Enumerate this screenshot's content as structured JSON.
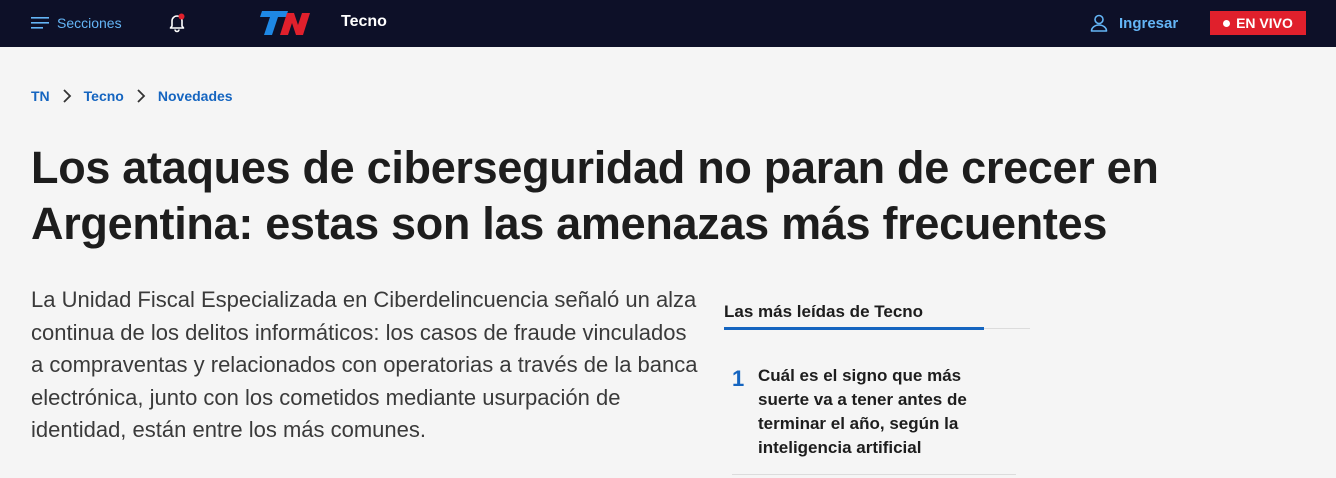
{
  "header": {
    "menu_label": "Secciones",
    "section": "Tecno",
    "login_label": "Ingresar",
    "live_label": "EN VIVO",
    "logo_alt": "TN",
    "icons": {
      "menu": "hamburger-icon",
      "notifications": "bell-icon",
      "login": "user-icon"
    },
    "colors": {
      "bar": "#0d1028",
      "accent": "#64b5f6",
      "live": "#e0202c"
    }
  },
  "breadcrumb": {
    "items": [
      "TN",
      "Tecno",
      "Novedades"
    ]
  },
  "article": {
    "headline": "Los ataques de ciberseguridad no paran de crecer en Argentina: estas son las amenazas más frecuentes",
    "lead": "La Unidad Fiscal Especializada en Ciberdelincuencia señaló un alza continua de los delitos informáticos: los casos de fraude vinculados a compraventas y relacionados con operatorias a través de la banca electrónica, junto con los cometidos mediante usurpación de identidad, están entre los más comunes."
  },
  "sidebar": {
    "title": "Las más leídas de Tecno",
    "items": [
      {
        "rank": "1",
        "title": "Cuál es el signo que más suerte va a tener antes de terminar el año, según la inteligencia artificial"
      }
    ]
  }
}
